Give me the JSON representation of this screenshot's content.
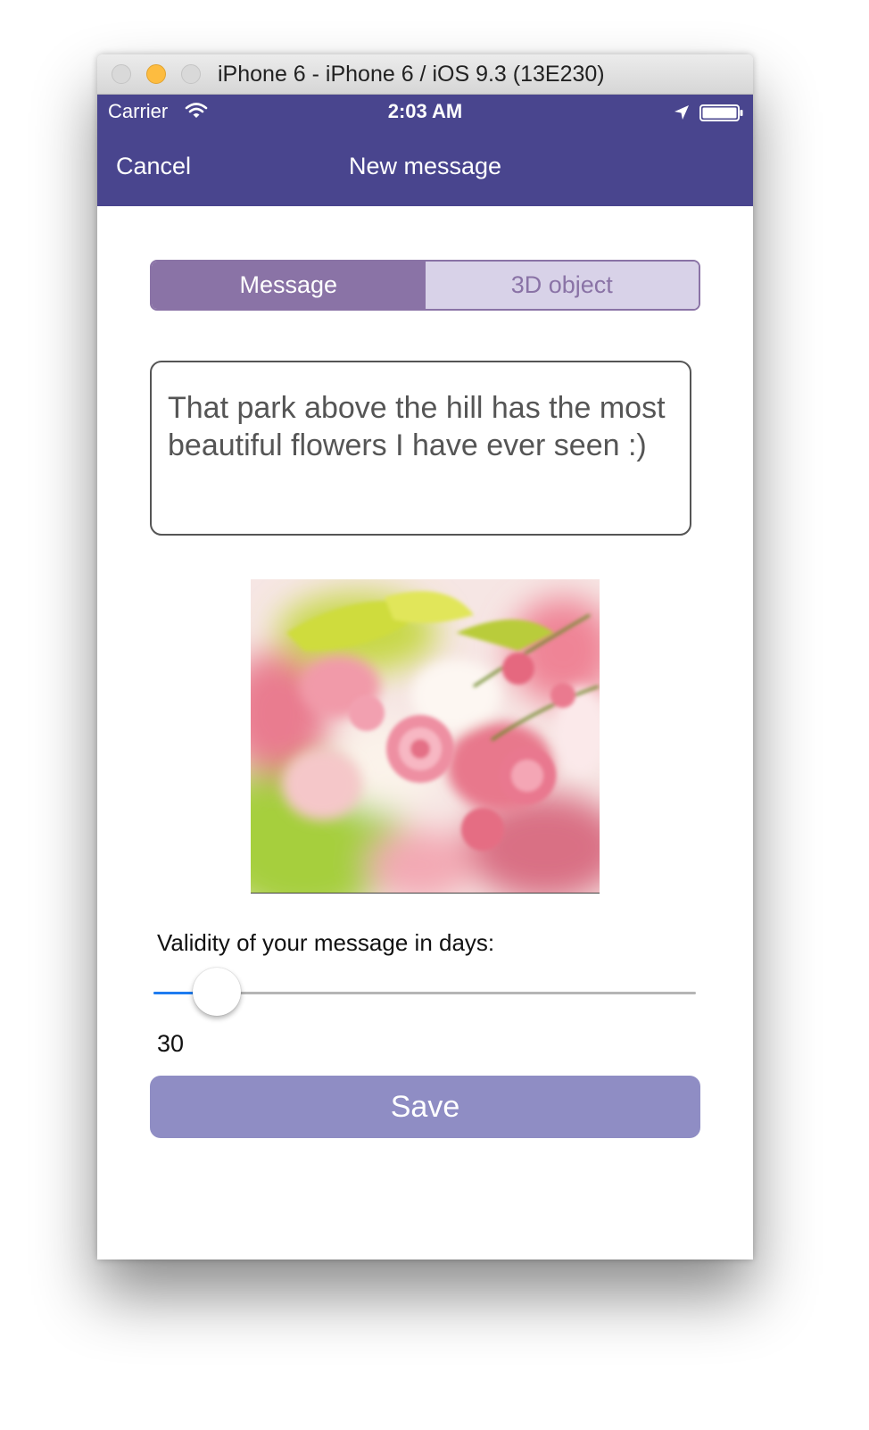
{
  "window": {
    "title": "iPhone 6 - iPhone 6 / iOS 9.3 (13E230)"
  },
  "status_bar": {
    "carrier": "Carrier",
    "time": "2:03 AM",
    "battery_level": 1.0,
    "icons": [
      "wifi-icon",
      "location-arrow-icon",
      "battery-icon"
    ]
  },
  "nav": {
    "cancel_label": "Cancel",
    "title": "New message"
  },
  "segments": {
    "items": [
      {
        "label": "Message",
        "selected": true
      },
      {
        "label": "3D object",
        "selected": false
      }
    ]
  },
  "message": {
    "text": "That park above the hill has the most beautiful flowers I have ever seen :)"
  },
  "photo": {
    "subject": "pink-flowers-photo"
  },
  "validity": {
    "label": "Validity of your message in days:",
    "value": "30",
    "slider_fraction": 0.117
  },
  "save_label": "Save",
  "colors": {
    "nav_bar": "#49458e",
    "segment_selected": "#8a73a6",
    "segment_unselected": "#d8d2e8",
    "slider_fill": "#1e7cf0",
    "save_button": "#8f8dc4"
  }
}
